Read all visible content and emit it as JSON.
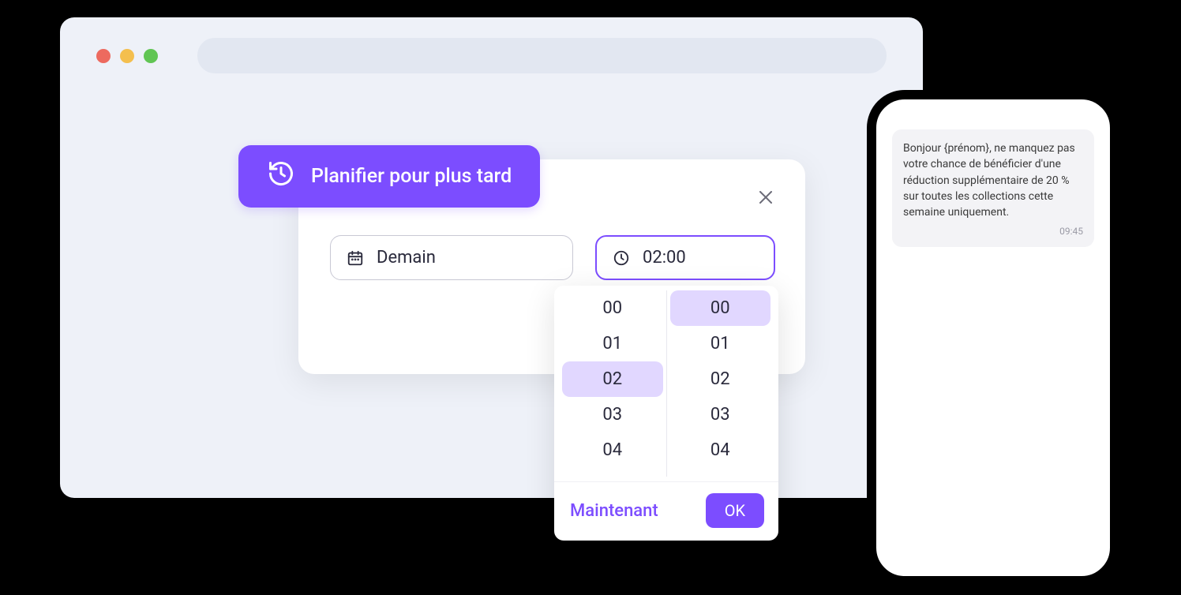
{
  "schedule": {
    "button_label": "Planifier pour plus tard",
    "date_value": "Demain",
    "time_value": "02:00"
  },
  "time_picker": {
    "hours": [
      "00",
      "01",
      "02",
      "03",
      "04"
    ],
    "minutes": [
      "00",
      "01",
      "02",
      "03",
      "04"
    ],
    "selected_hour_index": 2,
    "selected_minute_index": 0,
    "now_label": "Maintenant",
    "ok_label": "OK"
  },
  "sms": {
    "text": "Bonjour {prénom}, ne manquez pas votre chance de bénéficier d'une réduction supplémentaire de 20 % sur toutes les collections cette semaine uniquement.",
    "time": "09:45"
  },
  "colors": {
    "accent": "#7c4dff",
    "highlight": "#e1d7ff",
    "bg": "#eef1f8"
  }
}
